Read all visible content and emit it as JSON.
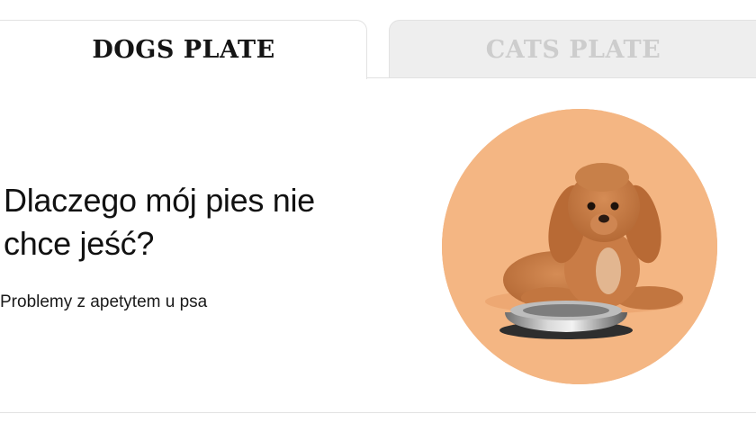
{
  "tabs": {
    "dogs_label": "DOGS PLATE",
    "cats_label": "CATS PLATE",
    "active": "dogs"
  },
  "article": {
    "headline": "Dlaczego mój pies nie chce jeść?",
    "subtitle": "Problemy z apetytem u psa",
    "image_icon": "dog-with-food-bowl"
  },
  "colors": {
    "active_tab_text": "#141414",
    "inactive_tab_text": "#cdcdcd",
    "inactive_tab_bg": "#eeeeee",
    "photo_bg": "#f4b683",
    "dog_fur": "#c87a45"
  }
}
